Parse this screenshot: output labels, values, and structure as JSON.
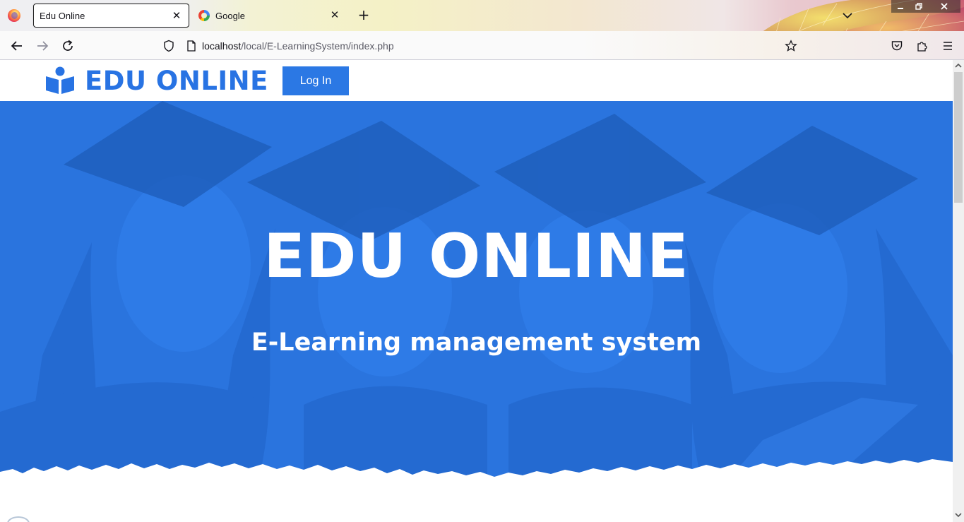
{
  "browser": {
    "tabs": [
      {
        "title": "Edu Online",
        "active": true,
        "icon": "page-icon"
      },
      {
        "title": "Google",
        "active": false,
        "icon": "google-icon"
      }
    ],
    "url_host": "localhost",
    "url_path": "/local/E-LearningSystem/index.php"
  },
  "site": {
    "brand": "EDU ONLINE",
    "login_label": "Log In",
    "brand_color": "#2873e3"
  },
  "hero": {
    "title": "EDU ONLINE",
    "subtitle": "E-Learning management system",
    "overlay_color": "#2a74de"
  }
}
